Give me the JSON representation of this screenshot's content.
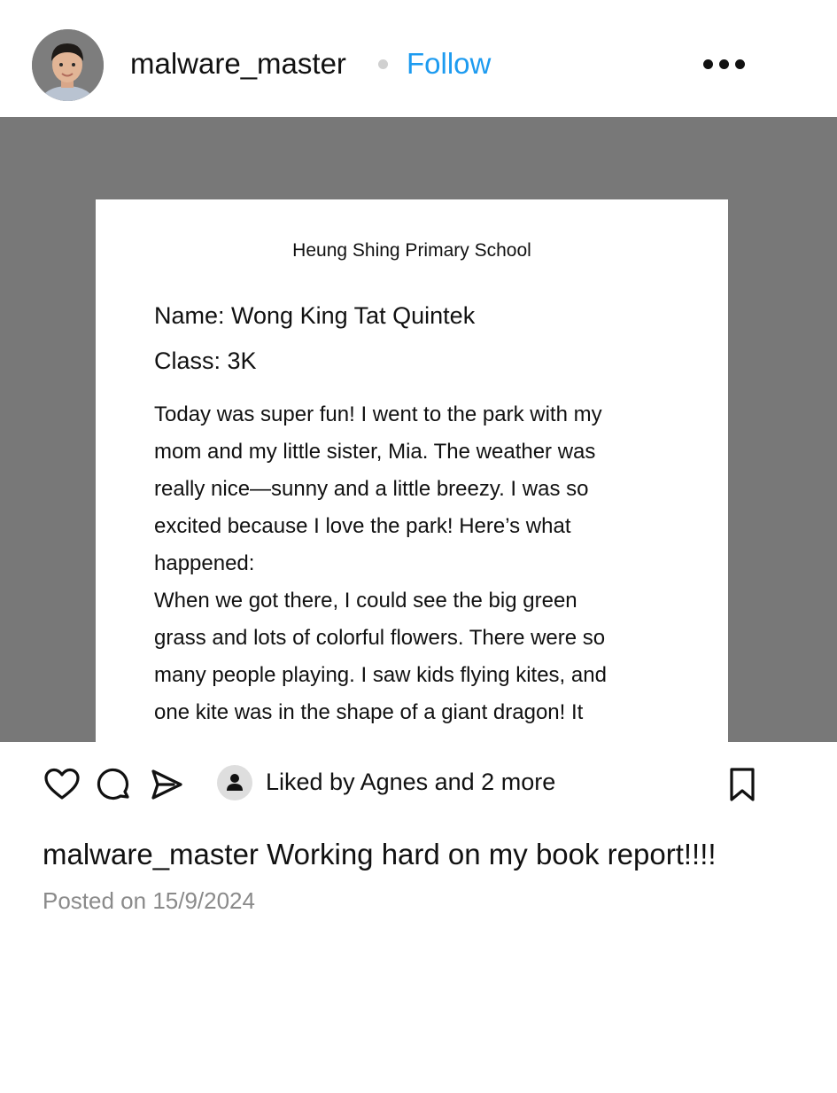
{
  "header": {
    "username": "malware_master",
    "follow_label": "Follow"
  },
  "document": {
    "school": "Heung Shing Primary School",
    "name_line": "Name: Wong King Tat Quintek",
    "class_line": "Class: 3K",
    "body_lines": [
      "Today was super fun! I went to the park with my",
      "mom and my little sister, Mia. The weather was",
      "really nice—sunny and a little breezy. I was so",
      "excited because I love the park! Here’s what",
      "happened:",
      "When we got there, I could see the big green",
      "grass and lots of colorful flowers. There were so",
      "many people playing. I saw kids flying kites, and",
      "one kite was in the shape of a giant dragon! It"
    ]
  },
  "actions": {
    "liked_by": "Liked by Agnes and 2 more"
  },
  "caption": {
    "username": "malware_master",
    "text": "Working hard on my book report!!!!",
    "posted": "Posted on 15/9/2024"
  },
  "colors": {
    "accent": "#1d9bf0",
    "image_bg": "#787878",
    "muted_text": "#8a8a8a"
  }
}
